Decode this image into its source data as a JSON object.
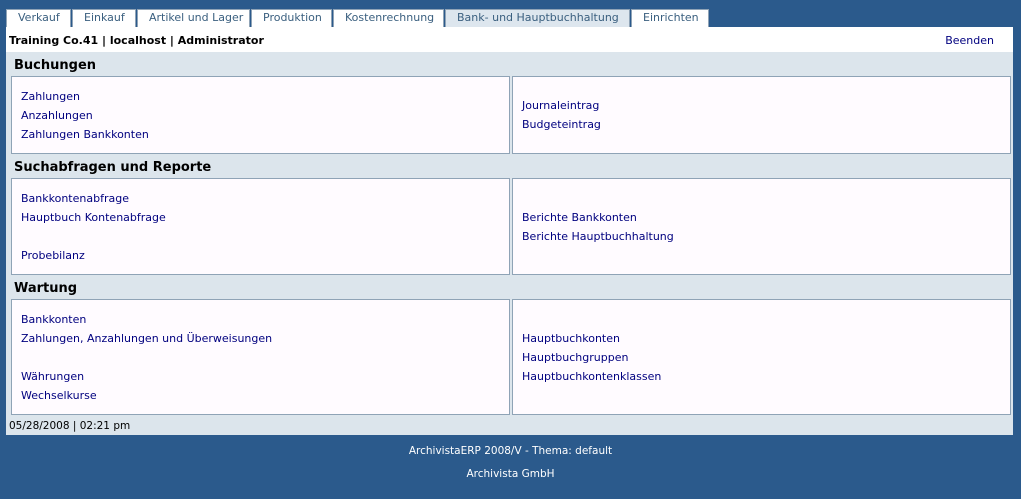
{
  "tabs": [
    {
      "label": "Verkauf",
      "active": false
    },
    {
      "label": "Einkauf",
      "active": false
    },
    {
      "label": "Artikel und Lager",
      "active": false
    },
    {
      "label": "Produktion",
      "active": false
    },
    {
      "label": "Kostenrechnung",
      "active": false
    },
    {
      "label": "Bank- und Hauptbuchhaltung",
      "active": true
    },
    {
      "label": "Einrichten",
      "active": false
    }
  ],
  "header": {
    "user_info": "Training Co.41 | localhost | Administrator",
    "logout_label": "Beenden"
  },
  "sections": [
    {
      "title": "Buchungen",
      "left_links": [
        "Zahlungen",
        "Anzahlungen",
        "Zahlungen Bankkonten"
      ],
      "right_links": [
        "Journaleintrag",
        "Budgeteintrag"
      ]
    },
    {
      "title": "Suchabfragen und Reporte",
      "left_links": [
        "Bankkontenabfrage",
        "Hauptbuch Kontenabfrage",
        "",
        "Probebilanz"
      ],
      "right_links": [
        "Berichte Bankkonten",
        "Berichte Hauptbuchhaltung"
      ]
    },
    {
      "title": "Wartung",
      "left_links": [
        "Bankkonten",
        "Zahlungen, Anzahlungen und Überweisungen",
        "",
        "Währungen",
        "Wechselkurse"
      ],
      "right_links": [
        "Hauptbuchkonten",
        "Hauptbuchgruppen",
        "Hauptbuchkontenklassen"
      ]
    }
  ],
  "status": {
    "datetime": "05/28/2008 | 02:21 pm"
  },
  "footer": {
    "version": "ArchivistaERP 2008/V - Thema: default",
    "company": "Archivista GmbH"
  }
}
